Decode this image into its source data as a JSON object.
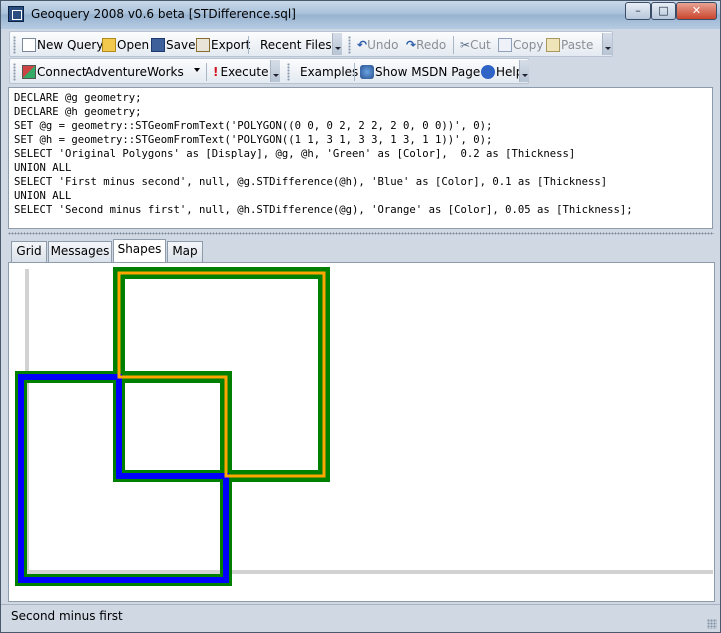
{
  "window": {
    "title": "Geoquery 2008 v0.6 beta [STDifference.sql]"
  },
  "toolbar1": {
    "new_query": "New Query",
    "open": "Open",
    "save": "Save",
    "export": "Export",
    "recent_files": "Recent Files",
    "undo": "Undo",
    "redo": "Redo",
    "cut": "Cut",
    "copy": "Copy",
    "paste": "Paste"
  },
  "toolbar2": {
    "connect": "Connect",
    "database": "AdventureWorks",
    "execute": "Execute",
    "examples": "Examples",
    "show_msdn": "Show MSDN Page",
    "help": "Help"
  },
  "editor": {
    "lines": [
      "DECLARE @g geometry;",
      "DECLARE @h geometry;",
      "SET @g = geometry::STGeomFromText('POLYGON((0 0, 0 2, 2 2, 2 0, 0 0))', 0);",
      "SET @h = geometry::STGeomFromText('POLYGON((1 1, 3 1, 3 3, 1 3, 1 1))', 0);",
      "SELECT 'Original Polygons' as [Display], @g, @h, 'Green' as [Color],  0.2 as [Thickness]",
      "UNION ALL",
      "SELECT 'First minus second', null, @g.STDifference(@h), 'Blue' as [Color], 0.1 as [Thickness]",
      "UNION ALL",
      "SELECT 'Second minus first', null, @h.STDifference(@g), 'Orange' as [Color], 0.05 as [Thickness];"
    ]
  },
  "tabs": [
    {
      "label": "Grid"
    },
    {
      "label": "Messages"
    },
    {
      "label": "Shapes"
    },
    {
      "label": "Map"
    }
  ],
  "shapes": {
    "colors": {
      "green": "#008000",
      "blue": "#0000ff",
      "orange": "#ffa500"
    }
  },
  "status": {
    "text": "Second minus first"
  }
}
